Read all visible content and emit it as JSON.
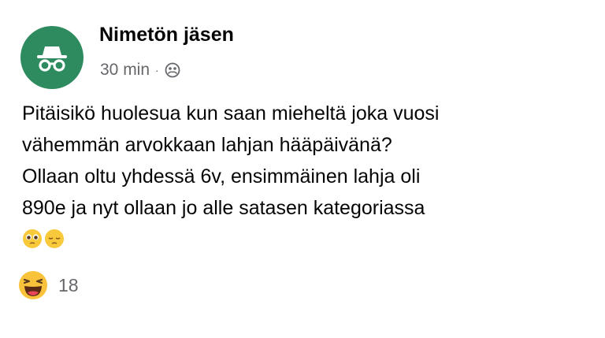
{
  "post": {
    "author_name": "Nimetön jäsen",
    "timestamp": "30 min",
    "separator": "·",
    "avatar_icon": "incognito-icon",
    "privacy_icon": "group-icon",
    "avatar_color": "#2e8b5f",
    "body_lines": [
      "Pitäisikö huolesua kun saan mieheltä joka vuosi",
      "vähemmän arvokkaan lahjan hääpäivänä?",
      "Ollaan oltu yhdessä 6v, ensimmäinen lahja oli",
      "890e ja nyt ollaan jo alle satasen kategoriassa"
    ],
    "body_emojis": [
      "pleading-face-icon",
      "pensive-face-icon"
    ],
    "reaction_icon": "haha-reaction-icon",
    "reaction_count": "18"
  }
}
